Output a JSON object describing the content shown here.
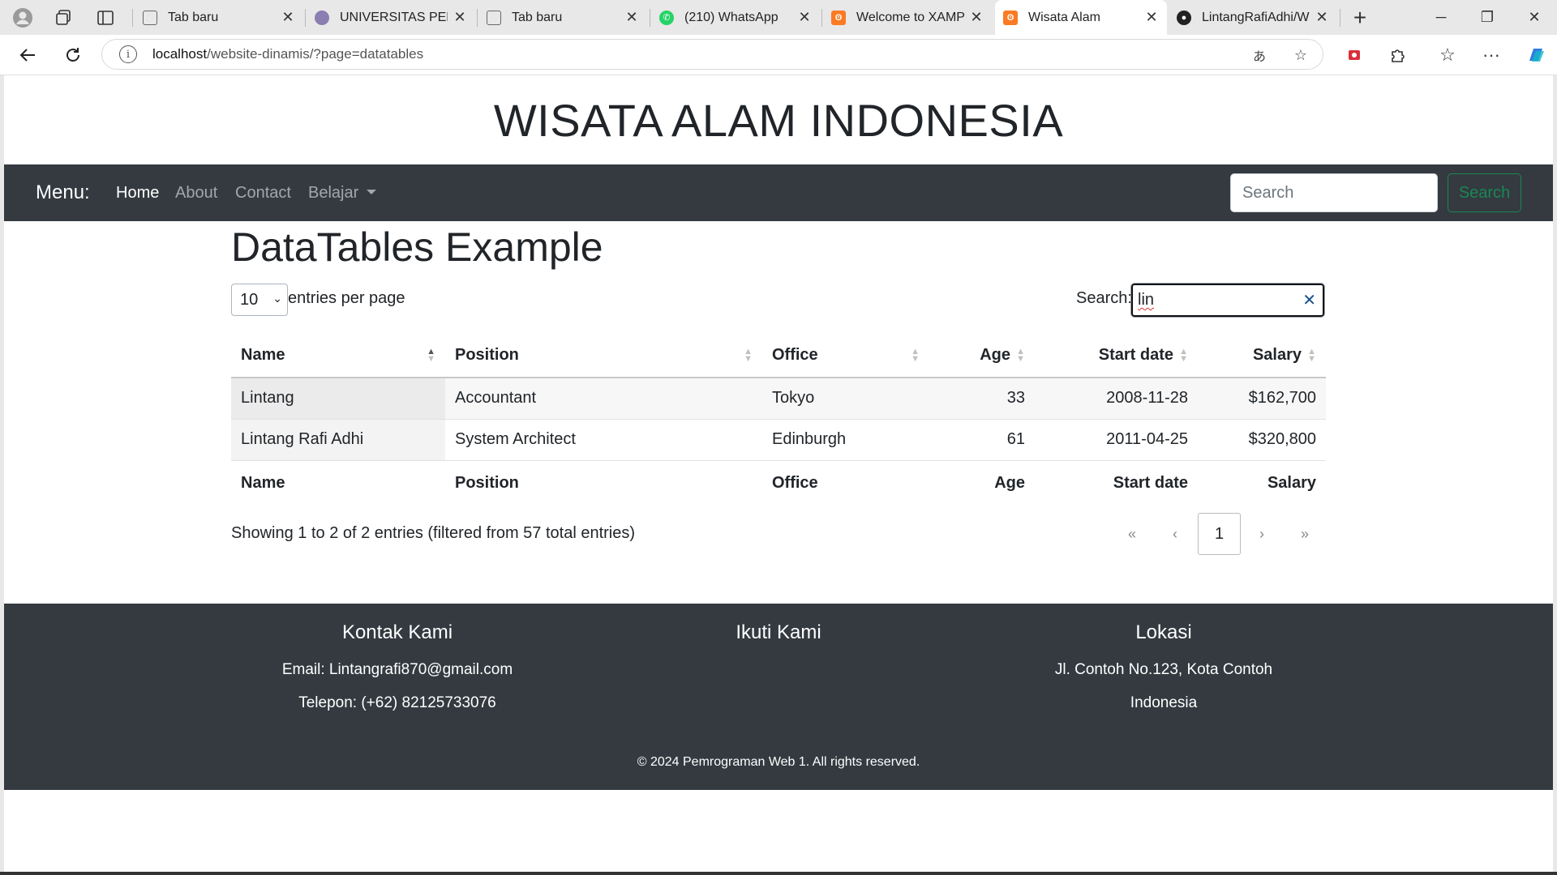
{
  "browser": {
    "tabs": [
      {
        "title": "Tab baru",
        "icon": "page-icon",
        "active": false
      },
      {
        "title": "UNIVERSITAS PELITA",
        "icon": "university-icon",
        "active": false
      },
      {
        "title": "Tab baru",
        "icon": "page-icon",
        "active": false
      },
      {
        "title": "(210) WhatsApp",
        "icon": "whatsapp-icon",
        "active": false
      },
      {
        "title": "Welcome to XAMPP",
        "icon": "xampp-icon",
        "active": false
      },
      {
        "title": "Wisata Alam",
        "icon": "xampp-icon",
        "active": true
      },
      {
        "title": "LintangRafiAdhi/We",
        "icon": "github-icon",
        "active": false
      }
    ],
    "url_host": "localhost",
    "url_path": "/website-dinamis/?page=datatables"
  },
  "site": {
    "title": "WISATA ALAM INDONESIA"
  },
  "navbar": {
    "brand": "Menu:",
    "links": [
      "Home",
      "About",
      "Contact",
      "Belajar"
    ],
    "active_link": "Home",
    "search_placeholder": "Search",
    "search_button": "Search"
  },
  "datatable": {
    "heading": "DataTables Example",
    "page_length": "10",
    "length_label": "entries per page",
    "search_label": "Search:",
    "search_value": "lin",
    "columns": [
      "Name",
      "Position",
      "Office",
      "Age",
      "Start date",
      "Salary"
    ],
    "sorted_column": "Name",
    "sort_direction": "ascending",
    "rows": [
      [
        "Lintang",
        "Accountant",
        "Tokyo",
        "33",
        "2008-11-28",
        "$162,700"
      ],
      [
        "Lintang Rafi Adhi",
        "System Architect",
        "Edinburgh",
        "61",
        "2011-04-25",
        "$320,800"
      ]
    ],
    "info": "Showing 1 to 2 of 2 entries (filtered from 57 total entries)",
    "pagination": [
      "«",
      "‹",
      "1",
      "›",
      "»"
    ],
    "current_page": "1"
  },
  "footer": {
    "columns": [
      {
        "heading": "Kontak Kami",
        "lines": [
          "Email: Lintangrafi870@gmail.com",
          "Telepon: (+62) 82125733076"
        ]
      },
      {
        "heading": "Ikuti Kami",
        "lines": []
      },
      {
        "heading": "Lokasi",
        "lines": [
          "Jl. Contoh No.123, Kota Contoh",
          "Indonesia"
        ]
      }
    ],
    "copyright": "© 2024 Pemrograman Web 1. All rights reserved."
  },
  "colors": {
    "navbar_bg": "#343a40",
    "success": "#198754",
    "footer_bg": "#343a40"
  }
}
